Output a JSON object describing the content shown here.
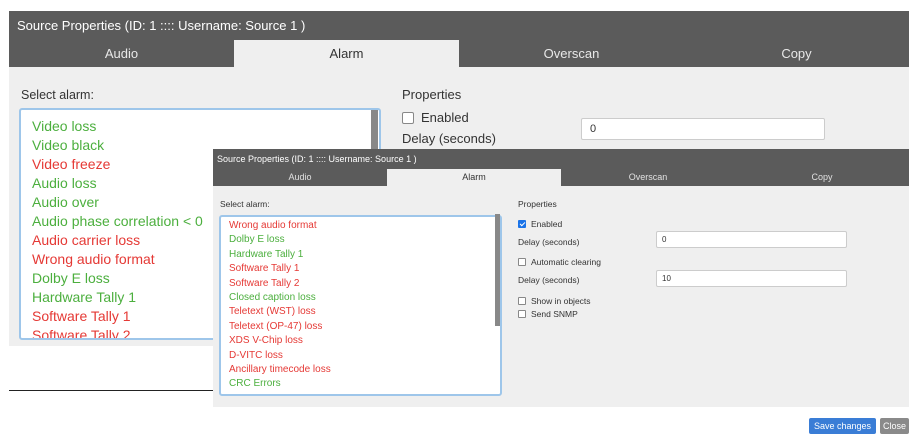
{
  "back_dialog": {
    "title": "Source Properties (ID: 1 :::: Username: Source 1 )",
    "tabs": [
      "Audio",
      "Alarm",
      "Overscan",
      "Copy"
    ],
    "active_tab": 1,
    "select_label": "Select alarm:",
    "alarms": [
      {
        "label": "Video loss",
        "color": "#4caf3e"
      },
      {
        "label": "Video black",
        "color": "#4caf3e"
      },
      {
        "label": "Video freeze",
        "color": "#e53935"
      },
      {
        "label": "Audio loss",
        "color": "#4caf3e"
      },
      {
        "label": "Audio over",
        "color": "#4caf3e"
      },
      {
        "label": "Audio phase correlation < 0",
        "color": "#4caf3e"
      },
      {
        "label": "Audio carrier loss",
        "color": "#e53935"
      },
      {
        "label": "Wrong audio format",
        "color": "#e53935"
      },
      {
        "label": "Dolby E loss",
        "color": "#4caf3e"
      },
      {
        "label": "Hardware Tally 1",
        "color": "#4caf3e"
      },
      {
        "label": "Software Tally 1",
        "color": "#e53935"
      },
      {
        "label": "Software Tally 2",
        "color": "#e53935"
      }
    ],
    "properties_label": "Properties",
    "enabled_label": "Enabled",
    "enabled_checked": false,
    "delay_label": "Delay (seconds)",
    "delay_value": "0"
  },
  "front_dialog": {
    "title": "Source Properties (ID: 1 :::: Username: Source 1 )",
    "tabs": [
      "Audio",
      "Alarm",
      "Overscan",
      "Copy"
    ],
    "active_tab": 1,
    "select_label": "Select alarm:",
    "alarms": [
      {
        "label": "Wrong audio format",
        "color": "#e53935"
      },
      {
        "label": "Dolby E loss",
        "color": "#4caf3e"
      },
      {
        "label": "Hardware Tally 1",
        "color": "#4caf3e"
      },
      {
        "label": "Software Tally 1",
        "color": "#e53935"
      },
      {
        "label": "Software Tally 2",
        "color": "#e53935"
      },
      {
        "label": "Closed caption loss",
        "color": "#4caf3e"
      },
      {
        "label": "Teletext (WST) loss",
        "color": "#e53935"
      },
      {
        "label": "Teletext (OP-47) loss",
        "color": "#e53935"
      },
      {
        "label": "XDS V-Chip loss",
        "color": "#e53935"
      },
      {
        "label": "D-VITC loss",
        "color": "#e53935"
      },
      {
        "label": "Ancillary timecode loss",
        "color": "#e53935"
      },
      {
        "label": "CRC Errors",
        "color": "#4caf3e"
      }
    ],
    "properties_label": "Properties",
    "enabled_label": "Enabled",
    "enabled_checked": true,
    "delay_label": "Delay (seconds)",
    "delay_value": "0",
    "auto_clear_label": "Automatic clearing",
    "auto_clear_checked": false,
    "delay2_label": "Delay (seconds)",
    "delay2_value": "10",
    "show_in_objects_label": "Show in objects",
    "send_snmp_label": "Send SNMP"
  },
  "footer": {
    "save_label": "Save changes",
    "close_label": "Close",
    "save_color": "#3a7dd6",
    "close_color": "#8a8a8a"
  }
}
